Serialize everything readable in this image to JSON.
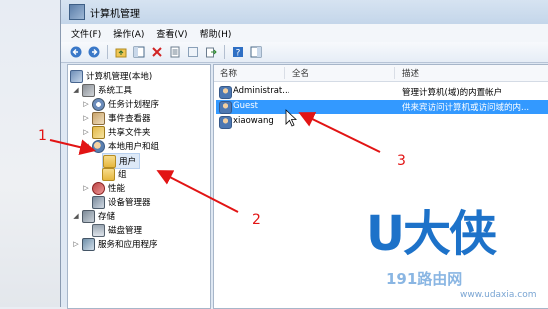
{
  "window": {
    "title": "计算机管理"
  },
  "menu": {
    "items": [
      "文件(F)",
      "操作(A)",
      "查看(V)",
      "帮助(H)"
    ]
  },
  "toolbar": {
    "icons": [
      "back-arrow-icon",
      "forward-arrow-icon",
      "up-folder-icon",
      "show-tree-icon",
      "delete-icon",
      "properties-icon",
      "refresh-icon",
      "export-icon",
      "help-icon",
      "show-action-pane-icon"
    ]
  },
  "tree": {
    "root": "计算机管理(本地)",
    "system_tools": "系统工具",
    "task_scheduler": "任务计划程序",
    "event_viewer": "事件查看器",
    "shared_folders": "共享文件夹",
    "local_users_groups": "本地用户和组",
    "users": "用户",
    "groups": "组",
    "performance": "性能",
    "device_manager": "设备管理器",
    "storage": "存储",
    "disk_management": "磁盘管理",
    "services_apps": "服务和应用程序"
  },
  "list": {
    "headers": {
      "name": "名称",
      "fullname": "全名",
      "description": "描述"
    },
    "rows": [
      {
        "name": "Administrat...",
        "fullname": "",
        "description": "管理计算机(域)的内置帐户"
      },
      {
        "name": "Guest",
        "fullname": "",
        "description": "供来宾访问计算机或访问域的内..."
      },
      {
        "name": "xiaowang",
        "fullname": "",
        "description": ""
      }
    ],
    "selected_index": 1
  },
  "annotations": {
    "n1": "1",
    "n2": "2",
    "n3": "3",
    "color": "#e21414"
  },
  "watermark": {
    "brand": "U大侠",
    "site": "191路由网",
    "url": "www.udaxia.com"
  },
  "colors": {
    "selection": "#3399ff",
    "accent": "#1d72c9"
  }
}
